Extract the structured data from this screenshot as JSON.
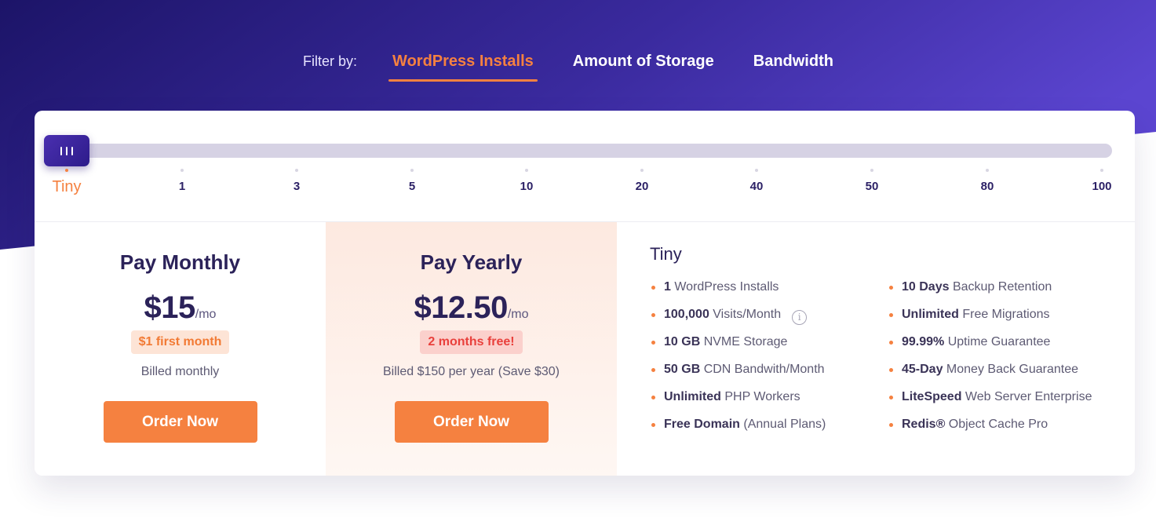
{
  "filter": {
    "label": "Filter by:",
    "tabs": [
      {
        "label": "WordPress Installs",
        "active": true
      },
      {
        "label": "Amount of Storage",
        "active": false
      },
      {
        "label": "Bandwidth",
        "active": false
      }
    ]
  },
  "slider": {
    "selected": "Tiny",
    "ticks": [
      "Tiny",
      "1",
      "3",
      "5",
      "10",
      "20",
      "40",
      "50",
      "80",
      "100"
    ]
  },
  "monthly": {
    "title": "Pay Monthly",
    "price": "$15",
    "per": "/mo",
    "promo": "$1 first month",
    "billed": "Billed monthly",
    "button": "Order Now"
  },
  "yearly": {
    "title": "Pay Yearly",
    "price": "$12.50",
    "per": "/mo",
    "promo": "2 months free!",
    "billed": "Billed $150 per year (Save $30)",
    "button": "Order Now"
  },
  "features": {
    "title": "Tiny",
    "left": [
      {
        "bold": "1",
        "text": " WordPress Installs"
      },
      {
        "bold": "100,000",
        "text": " Visits/Month",
        "info": true
      },
      {
        "bold": "10 GB",
        "text": " NVME Storage"
      },
      {
        "bold": "50 GB",
        "text": " CDN Bandwith/Month"
      },
      {
        "bold": "Unlimited",
        "text": " PHP Workers"
      },
      {
        "bold": "Free Domain",
        "text": " (Annual Plans)"
      }
    ],
    "right": [
      {
        "bold": "10 Days",
        "text": " Backup Retention"
      },
      {
        "bold": "Unlimited",
        "text": " Free Migrations"
      },
      {
        "bold": "99.99%",
        "text": " Uptime Guarantee"
      },
      {
        "bold": "45-Day",
        "text": " Money Back Guarantee"
      },
      {
        "bold": "LiteSpeed",
        "text": " Web Server Enterprise"
      },
      {
        "bold": "Redis®",
        "text": " Object Cache Pro"
      }
    ]
  },
  "icons": {
    "info": "info-icon",
    "grip": "slider-grip-icon",
    "bullet": "bullet-dot-icon"
  },
  "colors": {
    "accent": "#f58140",
    "brand_dark": "#1e1466",
    "brand_light": "#5b45d0",
    "yearly_promo": "#e9403c"
  }
}
